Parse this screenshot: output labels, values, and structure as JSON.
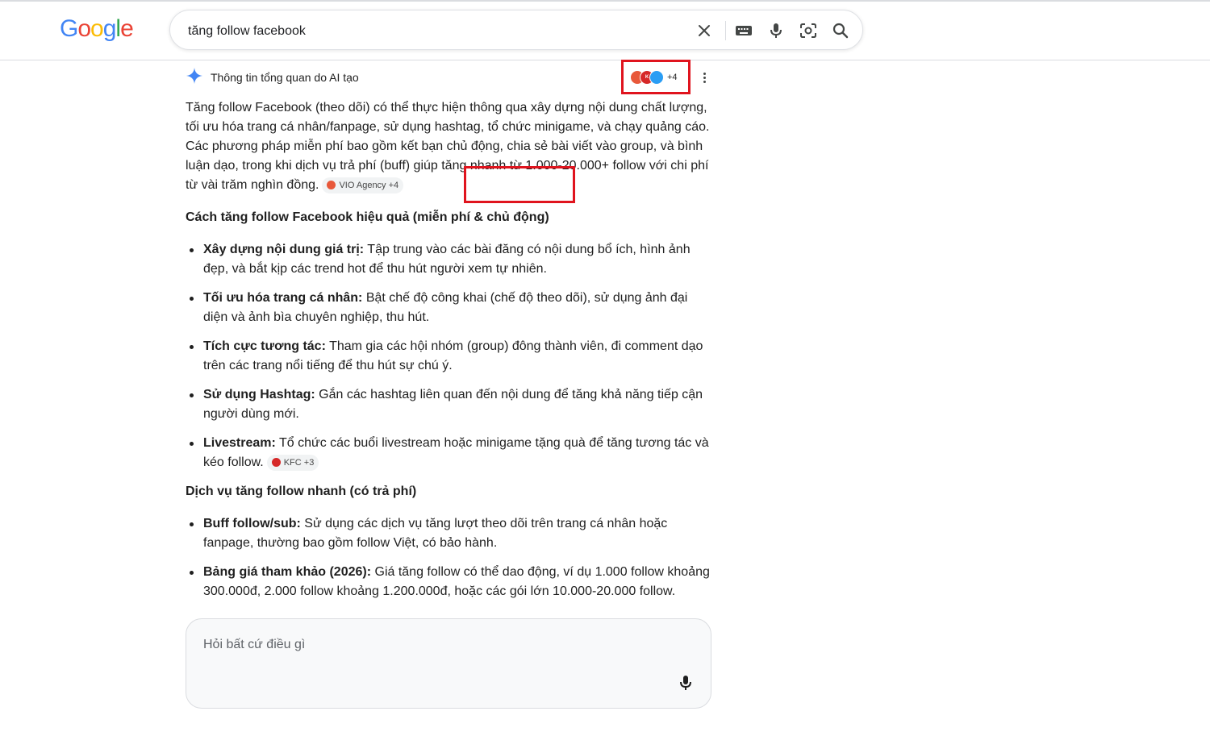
{
  "logo": {
    "letters": [
      "G",
      "o",
      "o",
      "g",
      "l",
      "e"
    ]
  },
  "search": {
    "value": "tăng follow facebook"
  },
  "icons": {
    "clear": "close-icon",
    "keyboard": "keyboard-icon",
    "voice": "mic-icon",
    "lens": "lens-icon",
    "search": "search-icon",
    "ai": "sparkle-icon",
    "more": "more-vert-icon"
  },
  "ai_overview": {
    "title": "Thông tin tổng quan do AI tạo",
    "sources_more": "+4",
    "intro": "Tăng follow Facebook (theo dõi) có thể thực hiện thông qua xây dựng nội dung chất lượng, tối ưu hóa trang cá nhân/fanpage, sử dụng hashtag, tổ chức minigame, và chạy quảng cáo. Các phương pháp miễn phí bao gồm kết bạn chủ động, chia sẻ bài viết vào group, và bình luận dạo, trong khi dịch vụ trả phí (buff) giúp tăng nhanh từ 1.000-20.000+ follow với chi phí từ vài trăm nghìn đồng.",
    "intro_citation": "VIO Agency +4",
    "section1_title": "Cách tăng follow Facebook hiệu quả (miễn phí & chủ động)",
    "section1_items": [
      {
        "bold": "Xây dựng nội dung giá trị:",
        "text": " Tập trung vào các bài đăng có nội dung bổ ích, hình ảnh đẹp, và bắt kịp các trend hot để thu hút người xem tự nhiên."
      },
      {
        "bold": "Tối ưu hóa trang cá nhân:",
        "text": " Bật chế độ công khai (chế độ theo dõi), sử dụng ảnh đại diện và ảnh bìa chuyên nghiệp, thu hút."
      },
      {
        "bold": "Tích cực tương tác:",
        "text": " Tham gia các hội nhóm (group) đông thành viên, đi comment dạo trên các trang nổi tiếng để thu hút sự chú ý."
      },
      {
        "bold": "Sử dụng Hashtag:",
        "text": " Gắn các hashtag liên quan đến nội dung để tăng khả năng tiếp cận người dùng mới."
      },
      {
        "bold": "Livestream:",
        "text": " Tổ chức các buổi livestream hoặc minigame tặng quà để tăng tương tác và kéo follow.",
        "citation": "KFC +3"
      }
    ],
    "section2_title": "Dịch vụ tăng follow nhanh (có trả phí)",
    "section2_items": [
      {
        "bold": "Buff follow/sub:",
        "text": " Sử dụng các dịch vụ tăng lượt theo dõi trên trang cá nhân hoặc fanpage, thường bao gồm follow Việt, có bảo hành."
      },
      {
        "bold": "Bảng giá tham khảo (2026):",
        "text": " Giá tăng follow có thể dao động, ví dụ 1.000 follow khoảng 300.000đ, 2.000 follow khoảng 1.200.000đ, hoặc các gói lớn 10.000-20.000 follow."
      }
    ]
  },
  "ask": {
    "placeholder": "Hỏi bất cứ điều gì"
  },
  "colors": {
    "highlight_box": "#e0141e",
    "google_blue": "#4285f4",
    "google_red": "#ea4335",
    "google_yellow": "#fbbc05",
    "google_green": "#34a853"
  }
}
